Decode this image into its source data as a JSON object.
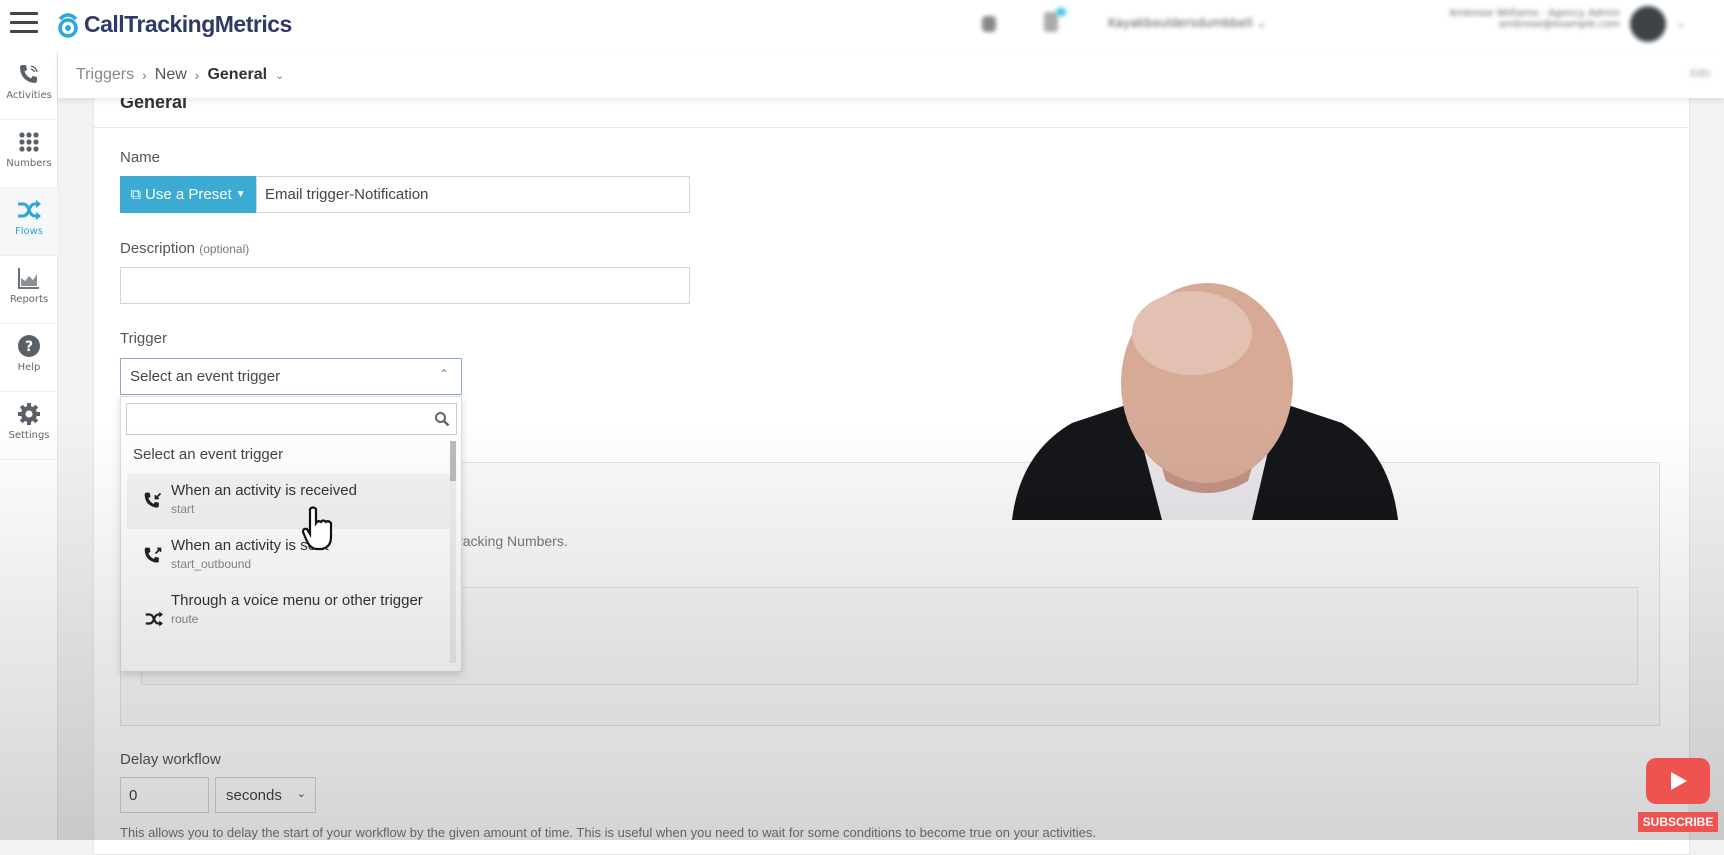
{
  "header": {
    "logo_text": "CallTrackingMetrics",
    "account_name": "Kayakbouldersdumbbell",
    "user_name": "Ambrose Williams · Agency Admin",
    "user_email": "ambrose@example.com",
    "info_label": "Info"
  },
  "sidebar": {
    "items": [
      {
        "label": "Activities",
        "icon": "phone-icon"
      },
      {
        "label": "Numbers",
        "icon": "grid-icon"
      },
      {
        "label": "Flows",
        "icon": "shuffle-icon",
        "active": true
      },
      {
        "label": "Reports",
        "icon": "chart-icon"
      },
      {
        "label": "Help",
        "icon": "help-icon"
      },
      {
        "label": "Settings",
        "icon": "gear-icon"
      }
    ]
  },
  "breadcrumb": {
    "items": [
      "Triggers",
      "New",
      "General"
    ]
  },
  "form": {
    "section_title": "General",
    "name_label": "Name",
    "preset_button": "Use a Preset",
    "name_value": "Email trigger-Notification",
    "description_label": "Description",
    "description_optional": "(optional)",
    "description_value": "",
    "trigger_label": "Trigger",
    "trigger_value": "Select an event trigger",
    "dropdown": {
      "search_value": "",
      "header": "Select an event trigger",
      "options": [
        {
          "label": "When an activity is received",
          "code": "start",
          "icon": "incoming-call-icon",
          "hovered": true
        },
        {
          "label": "When an activity is sent",
          "code": "start_outbound",
          "icon": "outgoing-call-icon"
        },
        {
          "label": "Through a voice menu or other trigger",
          "code": "route",
          "icon": "shuffle-icon"
        }
      ]
    },
    "partial_help": "Tracking Numbers.",
    "delay_label": "Delay workflow",
    "delay_value": "0",
    "delay_unit": "seconds",
    "delay_help": "This allows you to delay the start of your workflow by the given amount of time. This is useful when you need to wait for some conditions to become true on your activities."
  },
  "overlay": {
    "subscribe_label": "SUBSCRIBE"
  },
  "colors": {
    "brand": "#2ba7de",
    "preset_button": "#3cabd4",
    "subscribe": "#ef5350"
  }
}
